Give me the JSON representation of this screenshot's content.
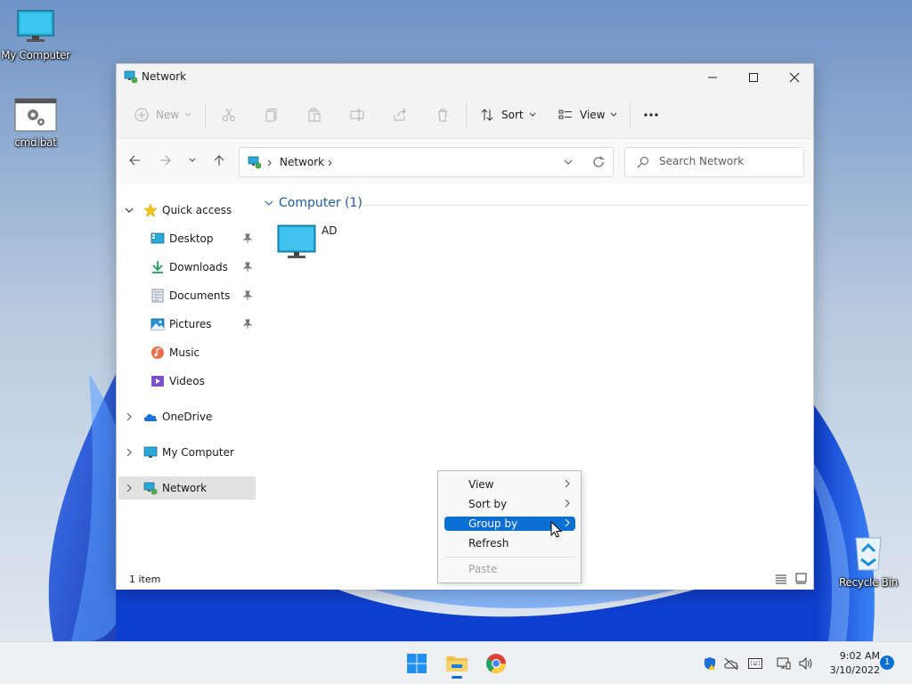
{
  "desktop": {
    "icons": [
      {
        "label": "My Computer",
        "icon": "monitor-icon"
      },
      {
        "label": "cmd.bat",
        "icon": "batch-file-icon"
      },
      {
        "label": "Recycle Bin",
        "icon": "recycle-bin-icon"
      }
    ]
  },
  "window": {
    "title": "Network",
    "controls": [
      "minimize-icon",
      "maximize-icon",
      "close-icon"
    ]
  },
  "toolbar": {
    "new_label": "New",
    "sort_label": "Sort",
    "view_label": "View",
    "actions": [
      "cut-icon",
      "copy-icon",
      "paste-icon",
      "rename-icon",
      "share-icon",
      "delete-icon",
      "more-icon"
    ]
  },
  "navigation": {
    "address_crumb": "Network",
    "search_placeholder": "Search Network"
  },
  "sidebar": {
    "items": [
      {
        "label": "Quick access",
        "icon": "star-icon"
      },
      {
        "label": "Desktop",
        "icon": "desktop-icon",
        "pinned": true
      },
      {
        "label": "Downloads",
        "icon": "download-icon",
        "pinned": true
      },
      {
        "label": "Documents",
        "icon": "document-icon",
        "pinned": true
      },
      {
        "label": "Pictures",
        "icon": "picture-icon",
        "pinned": true
      },
      {
        "label": "Music",
        "icon": "music-icon"
      },
      {
        "label": "Videos",
        "icon": "video-icon"
      },
      {
        "label": "OneDrive",
        "icon": "cloud-icon"
      },
      {
        "label": "My Computer",
        "icon": "monitor-icon"
      },
      {
        "label": "Network",
        "icon": "network-icon",
        "selected": true
      }
    ]
  },
  "content": {
    "group_header": "Computer (1)",
    "items": [
      {
        "label": "AD",
        "icon": "computer-icon"
      }
    ]
  },
  "status": {
    "item_count": "1 item"
  },
  "context_menu": {
    "items": [
      {
        "label": "View",
        "submenu": true
      },
      {
        "label": "Sort by",
        "submenu": true
      },
      {
        "label": "Group by",
        "submenu": true,
        "highlighted": true
      },
      {
        "label": "Refresh"
      },
      {
        "label": "Paste",
        "disabled": true
      }
    ]
  },
  "taskbar": {
    "apps": [
      "windows-start-icon",
      "file-explorer-icon",
      "chrome-icon"
    ],
    "tray": [
      "security-shield-icon",
      "cloud-offline-icon",
      "keyboard-icon",
      "network-status-icon",
      "volume-icon"
    ],
    "time": "9:02 AM",
    "date": "3/10/2022",
    "notification_count": "1"
  },
  "colors": {
    "accent": "#0a6fd1",
    "wallpaper_blue": "#1a4fd6"
  }
}
